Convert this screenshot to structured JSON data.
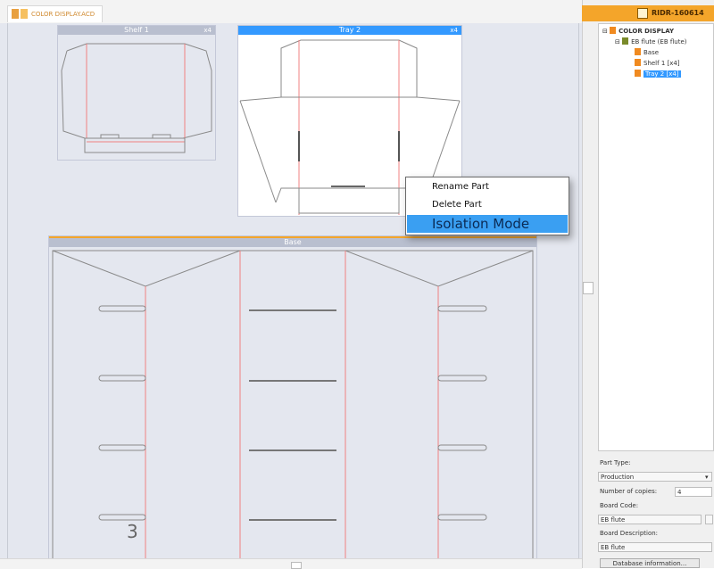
{
  "document_tab": {
    "title": "COLOR DISPLAY.ACD"
  },
  "header": {
    "code": "RIDR-160614"
  },
  "parts": {
    "shelf": {
      "title": "Shelf 1",
      "count": "x4"
    },
    "tray": {
      "title": "Tray 2",
      "count": "x4"
    },
    "base": {
      "title": "Base"
    }
  },
  "context_menu": {
    "items": [
      {
        "label": "Rename Part"
      },
      {
        "label": "Delete Part"
      },
      {
        "label": "Isolation Mode"
      }
    ]
  },
  "tree": {
    "root": "COLOR DISPLAY",
    "flute": "EB flute (EB flute)",
    "children": [
      "Base",
      "Shelf 1 [x4]",
      "Tray 2 [x4]"
    ]
  },
  "properties": {
    "part_type_label": "Part Type:",
    "part_type_value": "Production",
    "copies_label": "Number of copies:",
    "copies_value": "4",
    "board_code_label": "Board Code:",
    "board_code_value": "EB flute",
    "board_desc_label": "Board Description:",
    "board_desc_value": "EB flute",
    "db_button": "Database information..."
  },
  "page_number": "3",
  "colors": {
    "accent_orange": "#f4a52a",
    "selection_blue": "#3399ff",
    "cut_line": "#777777",
    "crease_line": "#f08080"
  }
}
